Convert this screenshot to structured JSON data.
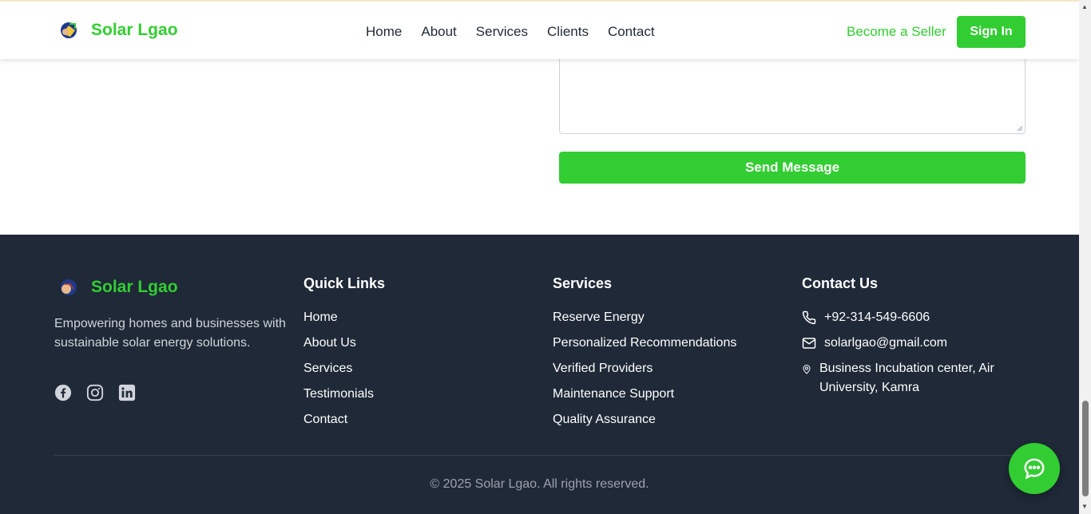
{
  "header": {
    "brand": "Solar Lgao",
    "nav": [
      "Home",
      "About",
      "Services",
      "Clients",
      "Contact"
    ],
    "become_seller": "Become a Seller",
    "sign_in": "Sign In"
  },
  "form": {
    "message_value": "",
    "send_label": "Send Message"
  },
  "footer": {
    "brand": "Solar Lgao",
    "tagline": "Empowering homes and businesses with sustainable solar energy solutions.",
    "socials": [
      "facebook-icon",
      "instagram-icon",
      "linkedin-icon"
    ],
    "quick_links": {
      "title": "Quick Links",
      "items": [
        "Home",
        "About Us",
        "Services",
        "Testimonials",
        "Contact"
      ]
    },
    "services": {
      "title": "Services",
      "items": [
        "Reserve Energy",
        "Personalized Recommendations",
        "Verified Providers",
        "Maintenance Support",
        "Quality Assurance"
      ]
    },
    "contact": {
      "title": "Contact Us",
      "phone": "+92-314-549-6606",
      "email": "solarlgao@gmail.com",
      "address": "Business Incubation center, Air University, Kamra"
    },
    "copyright": "© 2025 Solar Lgao. All rights reserved."
  },
  "colors": {
    "accent": "#32cd32",
    "footer_bg": "#1f2937"
  }
}
